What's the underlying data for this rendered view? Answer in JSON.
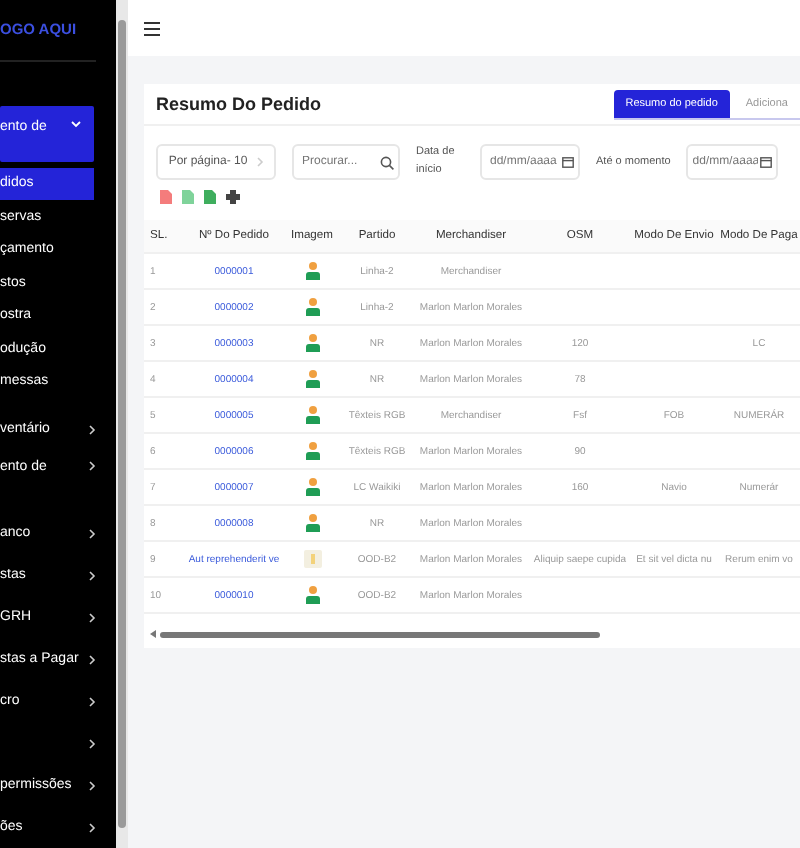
{
  "sidebar": {
    "logo": "OGO AQUI",
    "items": [
      {
        "label": "ento de",
        "expanded": true,
        "children": [
          {
            "label": "didos",
            "selected": true
          },
          {
            "label": "servas",
            "selected": false
          },
          {
            "label": "çamento",
            "selected": false
          },
          {
            "label": "stos",
            "selected": false
          },
          {
            "label": "ostra",
            "selected": false
          },
          {
            "label": "odução",
            "selected": false
          },
          {
            "label": "messas",
            "selected": false
          }
        ]
      },
      {
        "label": "ventário",
        "expanded": false
      },
      {
        "label": "ento de",
        "expanded": false
      },
      {
        "label": "anco",
        "expanded": false
      },
      {
        "label": "stas",
        "expanded": false
      },
      {
        "label": "GRH",
        "expanded": false
      },
      {
        "label": "stas a Pagar",
        "expanded": false
      },
      {
        "label": "cro",
        "expanded": false
      },
      {
        "expanded": false
      },
      {
        "label": "permissões",
        "expanded": false
      },
      {
        "label": "ões",
        "expanded": false
      }
    ]
  },
  "page": {
    "title": "Resumo Do Pedido",
    "tabs": [
      {
        "label": "Resumo do pedido",
        "selected": true
      },
      {
        "label": "Adiciona",
        "selected": false
      }
    ],
    "filters": {
      "per_page": "Por página- 10",
      "search_placeholder": "Procurar...",
      "start_label": "Data de início",
      "start_placeholder": "dd/mm/aaaa",
      "end_label": "Até o momento",
      "end_placeholder": "dd/mm/aaaa"
    },
    "table": {
      "columns": [
        "SL.",
        "Nº Do Pedido",
        "Imagem",
        "Partido",
        "Merchandiser",
        "OSM",
        "Modo De Envio",
        "Modo De Paga"
      ],
      "rows": [
        {
          "image": {
            "kind": "person"
          },
          "cells": [
            "1",
            "0000001",
            "",
            "Linha-2",
            "Merchandiser",
            "",
            "",
            ""
          ]
        },
        {
          "image": {
            "kind": "person"
          },
          "cells": [
            "2",
            "0000002",
            "",
            "Linha-2",
            "Marlon Marlon Morales",
            "",
            "",
            ""
          ]
        },
        {
          "image": {
            "kind": "person"
          },
          "cells": [
            "3",
            "0000003",
            "",
            "NR",
            "Marlon Marlon Morales",
            "120",
            "",
            "LC"
          ]
        },
        {
          "image": {
            "kind": "person"
          },
          "cells": [
            "4",
            "0000004",
            "",
            "NR",
            "Marlon Marlon Morales",
            "78",
            "",
            ""
          ]
        },
        {
          "image": {
            "kind": "person"
          },
          "cells": [
            "5",
            "0000005",
            "",
            "Têxteis RGB",
            "Merchandiser",
            "Fsf",
            "FOB",
            "NUMERÁR"
          ]
        },
        {
          "image": {
            "kind": "person"
          },
          "cells": [
            "6",
            "0000006",
            "",
            "Têxteis RGB",
            "Marlon Marlon Morales",
            "90",
            "",
            ""
          ]
        },
        {
          "image": {
            "kind": "person"
          },
          "cells": [
            "7",
            "0000007",
            "",
            "LC Waikiki",
            "Marlon Marlon Morales",
            "160",
            "Navio",
            "Numerár"
          ]
        },
        {
          "image": {
            "kind": "person"
          },
          "cells": [
            "8",
            "0000008",
            "",
            "NR",
            "Marlon Marlon Morales",
            "",
            "",
            ""
          ]
        },
        {
          "image": {
            "kind": "placeholder"
          },
          "cells": [
            "9",
            "Aut reprehenderit ve",
            "",
            "OOD-B2",
            "Marlon Marlon Morales",
            "Aliquip saepe cupida",
            "Et sit vel dicta nu",
            "Rerum enim vo"
          ]
        },
        {
          "image": {
            "kind": "person"
          },
          "cells": [
            "10",
            "0000010",
            "",
            "OOD-B2",
            "Marlon Marlon Morales",
            "",
            "",
            ""
          ]
        }
      ]
    }
  }
}
